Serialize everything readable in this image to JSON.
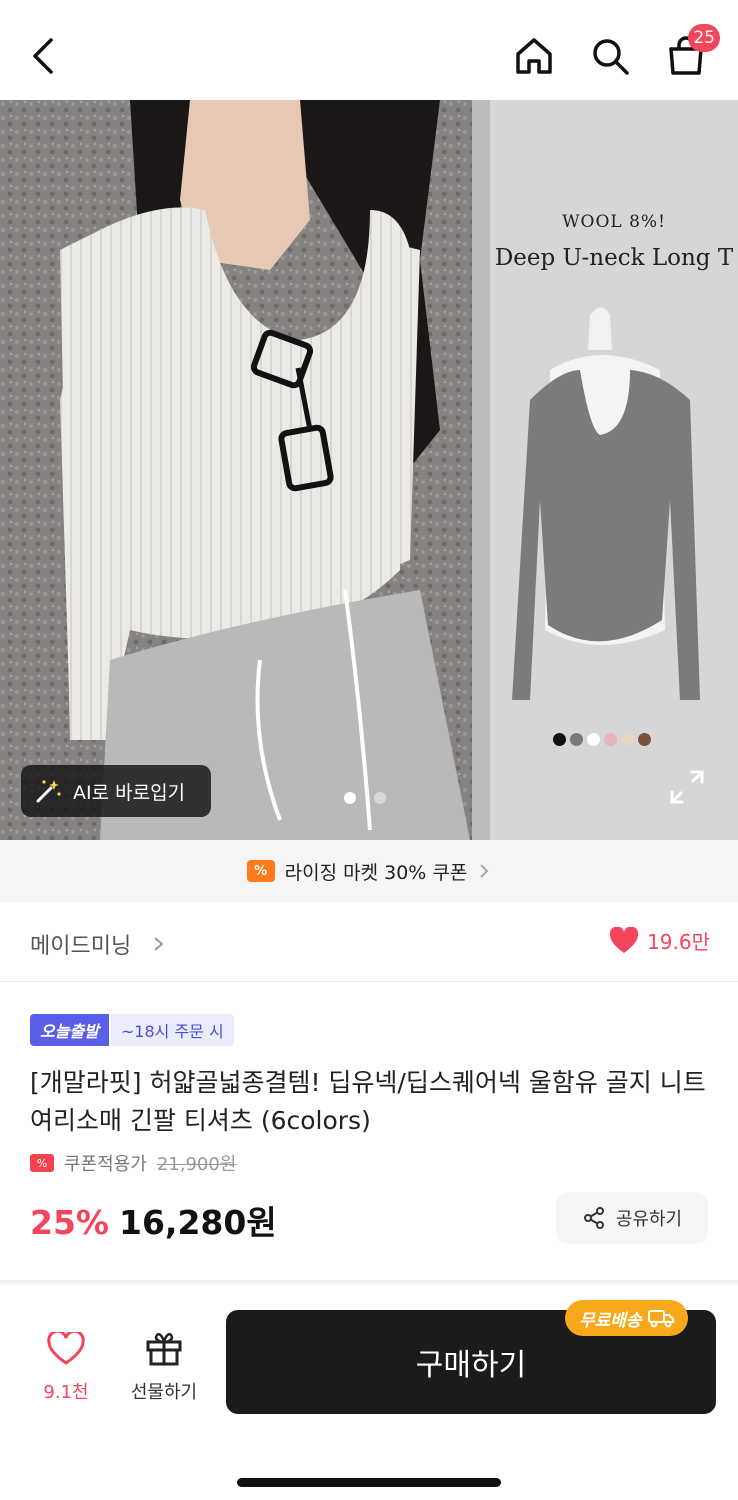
{
  "header": {
    "back_icon": "chevron-left-icon",
    "home_icon": "home-icon",
    "search_icon": "search-icon",
    "cart_icon": "shopping-bag-icon",
    "cart_count": "25"
  },
  "hero": {
    "caption_small": "WOOL 8%!",
    "caption_big": "Deep U-neck Long T",
    "swatch_colors": [
      "#111111",
      "#7a7a7a",
      "#ffffff",
      "#e8b4b4",
      "#e8d8c0",
      "#7a5236"
    ],
    "ai_button_label": "AI로 바로입기",
    "ai_icon": "magic-wand-icon",
    "page_dots": 2,
    "active_page": 1,
    "expand_icon": "expand-icon"
  },
  "coupon_banner": {
    "icon_text": "%",
    "label": "라이징 마켓 30% 쿠폰"
  },
  "brand": {
    "name": "메이드미닝",
    "like_count": "19.6만"
  },
  "tags": {
    "today": "오늘출발",
    "time": "~18시 주문 시"
  },
  "product": {
    "title": "[개말라핏] 허얇골넓종결템! 딥유넥/딥스퀘어넥 울함유 골지 니트 여리소매 긴팔 티셔츠 (6colors)",
    "coupon_label": "쿠폰적용가",
    "original_price": "21,900원",
    "discount": "25%",
    "price": "16,280원",
    "share_label": "공유하기"
  },
  "bottom": {
    "wish_count": "9.1천",
    "gift_label": "선물하기",
    "buy_label": "구매하기",
    "free_shipping": "무료배송"
  },
  "colors": {
    "accent": "#f4465a",
    "buy_button": "#1b1b1b",
    "free_ship": "#f7a81b",
    "today_tag": "#5a5ee8"
  }
}
